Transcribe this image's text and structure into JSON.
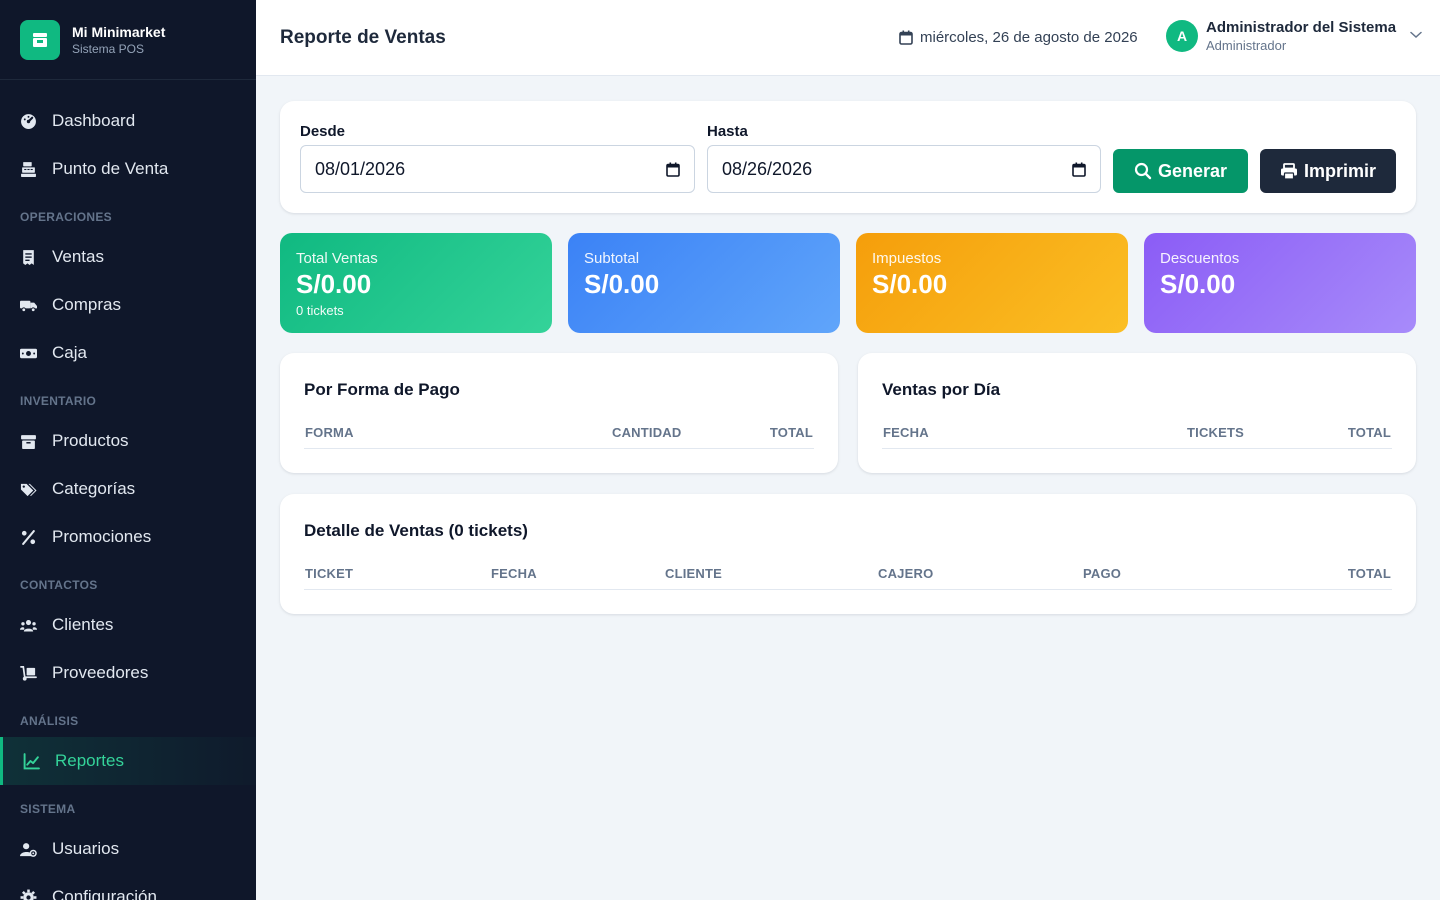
{
  "brand": {
    "name": "Mi Minimarket",
    "subtitle": "Sistema POS"
  },
  "sidebar": {
    "top_items": [
      {
        "label": "Dashboard",
        "icon": "gauge-icon"
      },
      {
        "label": "Punto de Venta",
        "icon": "cash-register-icon"
      }
    ],
    "sections": [
      {
        "title": "OPERACIONES",
        "items": [
          {
            "label": "Ventas",
            "icon": "receipt-icon"
          },
          {
            "label": "Compras",
            "icon": "truck-icon"
          },
          {
            "label": "Caja",
            "icon": "money-icon"
          }
        ]
      },
      {
        "title": "INVENTARIO",
        "items": [
          {
            "label": "Productos",
            "icon": "box-icon"
          },
          {
            "label": "Categorías",
            "icon": "tags-icon"
          },
          {
            "label": "Promociones",
            "icon": "percent-icon"
          }
        ]
      },
      {
        "title": "CONTACTOS",
        "items": [
          {
            "label": "Clientes",
            "icon": "users-icon"
          },
          {
            "label": "Proveedores",
            "icon": "dolly-icon"
          }
        ]
      },
      {
        "title": "ANÁLISIS",
        "items": [
          {
            "label": "Reportes",
            "icon": "chart-line-icon",
            "active": true
          }
        ]
      },
      {
        "title": "SISTEMA",
        "items": [
          {
            "label": "Usuarios",
            "icon": "user-gear-icon"
          },
          {
            "label": "Configuración",
            "icon": "gear-icon"
          }
        ]
      }
    ]
  },
  "header": {
    "title": "Reporte de Ventas",
    "date": "miércoles, 26 de agosto de 2026",
    "user": {
      "initial": "A",
      "name": "Administrador del Sistema",
      "role": "Administrador"
    }
  },
  "filters": {
    "from_label": "Desde",
    "from_value": "08/01/2026",
    "to_label": "Hasta",
    "to_value": "08/26/2026",
    "generate_label": "Generar",
    "print_label": "Imprimir"
  },
  "stats": {
    "total": {
      "label": "Total Ventas",
      "value": "S/0.00",
      "sub": "0 tickets"
    },
    "subtotal": {
      "label": "Subtotal",
      "value": "S/0.00"
    },
    "taxes": {
      "label": "Impuestos",
      "value": "S/0.00"
    },
    "discounts": {
      "label": "Descuentos",
      "value": "S/0.00"
    }
  },
  "payment_table": {
    "title": "Por Forma de Pago",
    "columns": [
      "FORMA",
      "CANTIDAD",
      "TOTAL"
    ],
    "rows": []
  },
  "daily_table": {
    "title": "Ventas por Día",
    "columns": [
      "FECHA",
      "TICKETS",
      "TOTAL"
    ],
    "rows": []
  },
  "detail_table": {
    "title": "Detalle de Ventas (0 tickets)",
    "columns": [
      "TICKET",
      "FECHA",
      "CLIENTE",
      "CAJERO",
      "PAGO",
      "TOTAL"
    ],
    "rows": []
  },
  "colors": {
    "sidebar_bg": "#0f172a",
    "accent": "#10b981",
    "stat_green": "#10b981",
    "stat_blue": "#3b82f6",
    "stat_orange": "#f59e0b",
    "stat_purple": "#8b5cf6"
  }
}
